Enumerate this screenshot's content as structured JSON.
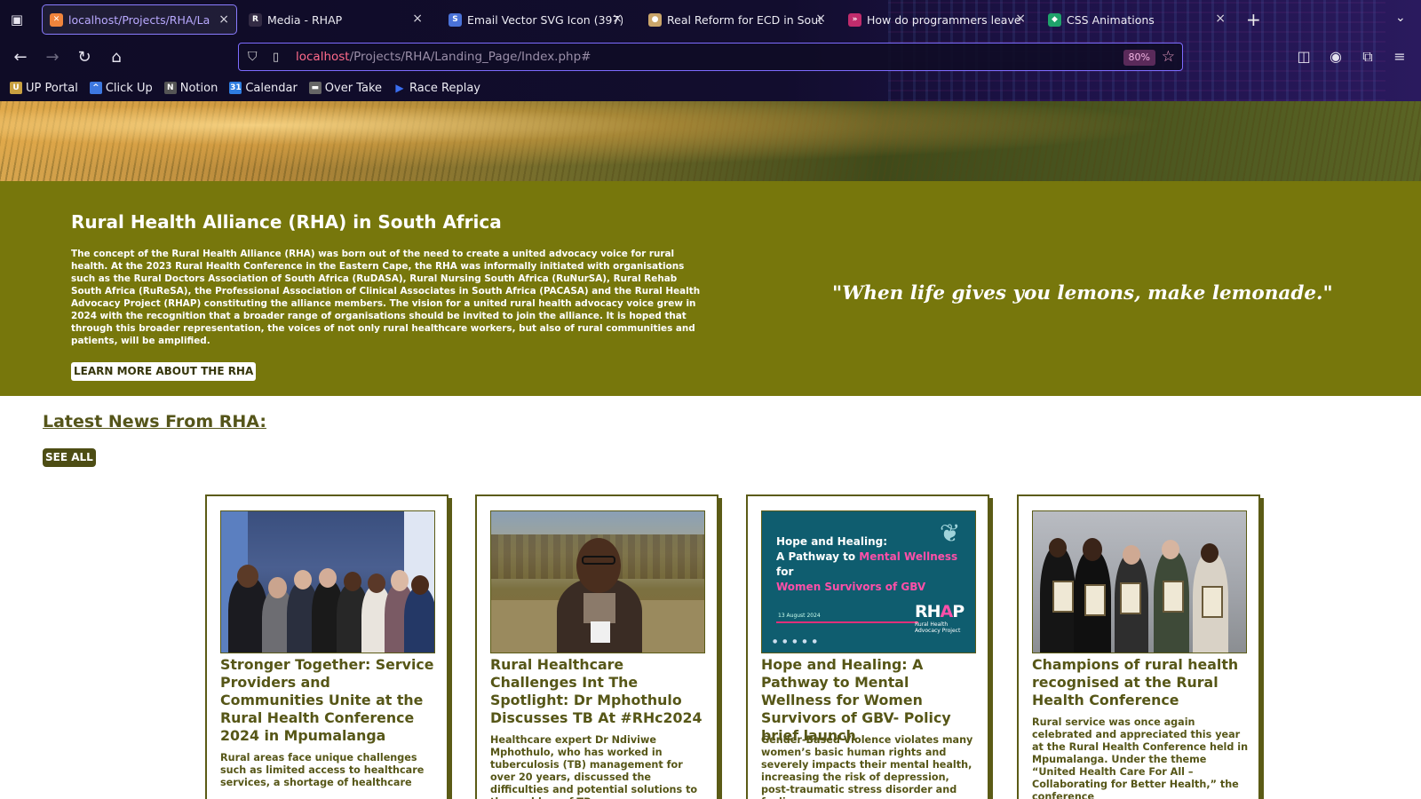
{
  "browser": {
    "tabs": [
      {
        "title": "localhost/Projects/RHA/La",
        "active": true,
        "favicon": "xampp-icon"
      },
      {
        "title": "Media - RHAP",
        "active": false,
        "favicon": "rhap-icon"
      },
      {
        "title": "Email Vector SVG Icon (397)",
        "active": false,
        "favicon": "svg-repo-icon"
      },
      {
        "title": "Real Reform for ECD in Sout",
        "active": false,
        "favicon": "ecd-icon"
      },
      {
        "title": "How do programmers leave",
        "active": false,
        "favicon": "video-icon"
      },
      {
        "title": "CSS Animations",
        "active": false,
        "favicon": "codepen-icon"
      }
    ],
    "url_host": "localhost",
    "url_path": "/Projects/RHA/Landing_Page/Index.php#",
    "zoom": "80%",
    "bookmarks": [
      {
        "label": "UP Portal",
        "icon": "up-icon",
        "color": "#c8a040"
      },
      {
        "label": "Click Up",
        "icon": "clickup-icon",
        "color": "#3d78e0"
      },
      {
        "label": "Notion",
        "icon": "notion-icon",
        "color": "#555555"
      },
      {
        "label": "Calendar",
        "icon": "calendar-icon",
        "color": "#2e7de0"
      },
      {
        "label": "Over Take",
        "icon": "overtake-icon",
        "color": "#666666"
      },
      {
        "label": "Race Replay",
        "icon": "play-icon",
        "color": "#3a6ef0"
      }
    ]
  },
  "about": {
    "title": "Rural Health Alliance (RHA) in South Africa",
    "description": "The concept of the Rural Health Alliance (RHA) was born out of the need to create a united advocacy voice for rural health. At the 2023 Rural Health Conference in the Eastern Cape, the RHA was informally initiated with organisations such as the Rural Doctors Association of South Africa (RuDASA), Rural Nursing South Africa (RuNurSA), Rural Rehab South Africa (RuReSA), the Professional Association of Clinical Associates in South Africa (PACASA) and the Rural Health Advocacy Project (RHAP) constituting the alliance members. The vision for a united rural health advocacy voice grew in 2024 with the recognition that a broader range of organisations should be invited to join the alliance. It is hoped that through this broader representation, the voices of not only rural healthcare workers, but also of rural communities and patients, will be amplified.",
    "button": "LEARN MORE ABOUT THE RHA",
    "quote": "\"When life gives you lemons, make lemonade.\""
  },
  "news": {
    "title": "Latest News From RHA:",
    "see_all": "SEE ALL",
    "cards": [
      {
        "title": "Stronger Together: Service Providers and Communities Unite at the Rural Health Conference 2024 in Mpumalanga",
        "body": "Rural areas face unique challenges such as limited access to healthcare services, a shortage of healthcare"
      },
      {
        "title": "Rural Healthcare Challenges Int The Spotlight: Dr Mphothulo Discusses TB At #RHc2024",
        "body": "Healthcare expert Dr Ndiviwe Mphothulo, who has worked in tuberculosis (TB) management for over 20 years, discussed the difficulties and potential solutions to the problem of TB"
      },
      {
        "title": "Hope and Healing: A Pathway to Mental Wellness for Women Survivors of GBV- Policy brief launch",
        "body": "Gender-Based Violence violates many women’s basic human rights and severely impacts their mental health, increasing the risk of depression, post-traumatic stress disorder and feelings"
      },
      {
        "title": "Champions of rural health recognised at the Rural Health Conference",
        "body": "Rural service was once again celebrated and appreciated this year at the Rural Health Conference held in Mpumalanga. Under the theme “United Health Care For All – Collaborating for Better Health,” the conference"
      }
    ],
    "poster": {
      "line1": "Hope and Healing:",
      "line2a": "A Pathway to ",
      "line2b": "Mental Wellness",
      "line2c": " for",
      "line3": "Women Survivors of GBV",
      "date": "13 August 2024",
      "logo_a": "RH",
      "logo_b": "A",
      "logo_c": "P",
      "logo_sub": "Rural Health Advocacy Project"
    }
  }
}
